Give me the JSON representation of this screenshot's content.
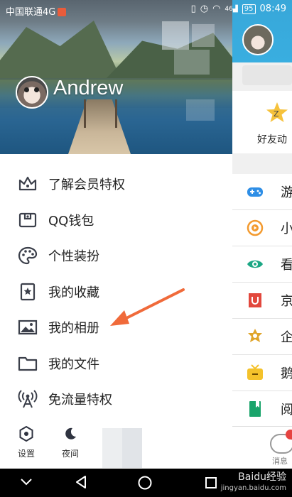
{
  "status_bar": {
    "carrier": "中国联通4G",
    "signal_label": "46",
    "battery": "95",
    "time": "08:49"
  },
  "profile": {
    "username": "Andrew"
  },
  "menu": {
    "items": [
      {
        "label": "了解会员特权",
        "icon": "crown-icon"
      },
      {
        "label": "QQ钱包",
        "icon": "wallet-icon"
      },
      {
        "label": "个性装扮",
        "icon": "palette-icon"
      },
      {
        "label": "我的收藏",
        "icon": "bookmark-star-icon"
      },
      {
        "label": "我的相册",
        "icon": "image-icon"
      },
      {
        "label": "我的文件",
        "icon": "folder-icon"
      },
      {
        "label": "免流量特权",
        "icon": "broadcast-icon"
      }
    ]
  },
  "bottom_actions": {
    "settings_label": "设置",
    "night_label": "夜间"
  },
  "right_panel": {
    "fun_label": "好友动",
    "rows": [
      {
        "label": "游",
        "icon": "gamepad-icon",
        "color": "#2e8ee6"
      },
      {
        "label": "小",
        "icon": "play-circle-icon",
        "color": "#f39a2e"
      },
      {
        "label": "看",
        "icon": "eye-icon",
        "color": "#1ba784"
      },
      {
        "label": "京",
        "icon": "shop-icon",
        "color": "#e2483d"
      },
      {
        "label": "企",
        "icon": "badge-icon",
        "color": "#e0a52a"
      },
      {
        "label": "鹅",
        "icon": "tv-icon",
        "color": "#f4c22b"
      },
      {
        "label": "阅",
        "icon": "book-icon",
        "color": "#1aa46b"
      }
    ],
    "tab_label": "消息"
  },
  "watermark": {
    "brand": "Baidu经验",
    "url": "jingyan.baidu.com"
  },
  "colors": {
    "accent_blue": "#39aee0",
    "arrow": "#f06a3a"
  }
}
